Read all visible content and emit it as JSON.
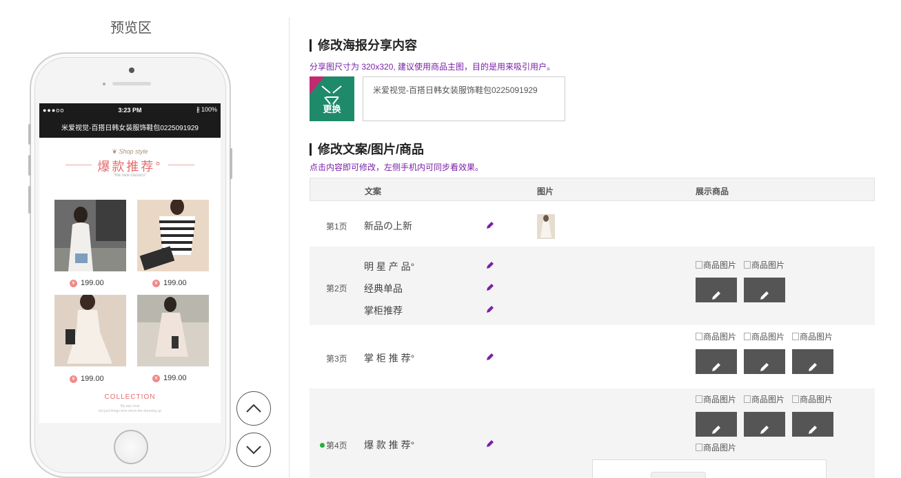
{
  "preview": {
    "title": "预览区",
    "status_bar": {
      "signal": "●●●oo",
      "wifi": "ᯤ",
      "time": "3:23 PM",
      "battery": "∦ 100%"
    },
    "nav_title": "米爱视觉-百搭日韩女装服饰鞋包0225091929",
    "banner": {
      "script": "Shop style",
      "heading": "爆款推荐°",
      "sub": "\"the new classics\""
    },
    "products": [
      {
        "price": "199.00"
      },
      {
        "price": "199.00"
      },
      {
        "price": "199.00"
      },
      {
        "price": "199.00"
      }
    ],
    "collection": {
      "heading": "COLLECTION",
      "sub_line1": "My epic look",
      "sub_line2": "but just things time drove the dressing up"
    }
  },
  "share": {
    "title": "修改海报分享内容",
    "hint": "分享图尺寸为 320x320, 建议使用商品主图，目的是用来吸引用户。",
    "change_label": "更换",
    "text_value": "米爱视觉-百搭日韩女装服饰鞋包0225091929"
  },
  "copy": {
    "title": "修改文案/图片/商品",
    "hint": "点击内容即可修改，左侧手机内可同步看效果。",
    "headers": {
      "text": "文案",
      "image": "图片",
      "goods": "展示商品"
    },
    "goods_alt": "商品图片",
    "rows": [
      {
        "page": "第1页",
        "texts": [
          "新品の上新"
        ]
      },
      {
        "page": "第2页",
        "texts": [
          "明 星 产 品°",
          "经典单品",
          "掌柜推荐"
        ]
      },
      {
        "page": "第3页",
        "texts": [
          "掌 柜 推 荐°"
        ]
      },
      {
        "page": "第4页",
        "texts": [
          "爆 款 推 荐°"
        ]
      }
    ]
  },
  "colors": {
    "accent_purple": "#7a1fa8",
    "active_green": "#1bb43a",
    "heading_pink": "#e26d6d"
  }
}
